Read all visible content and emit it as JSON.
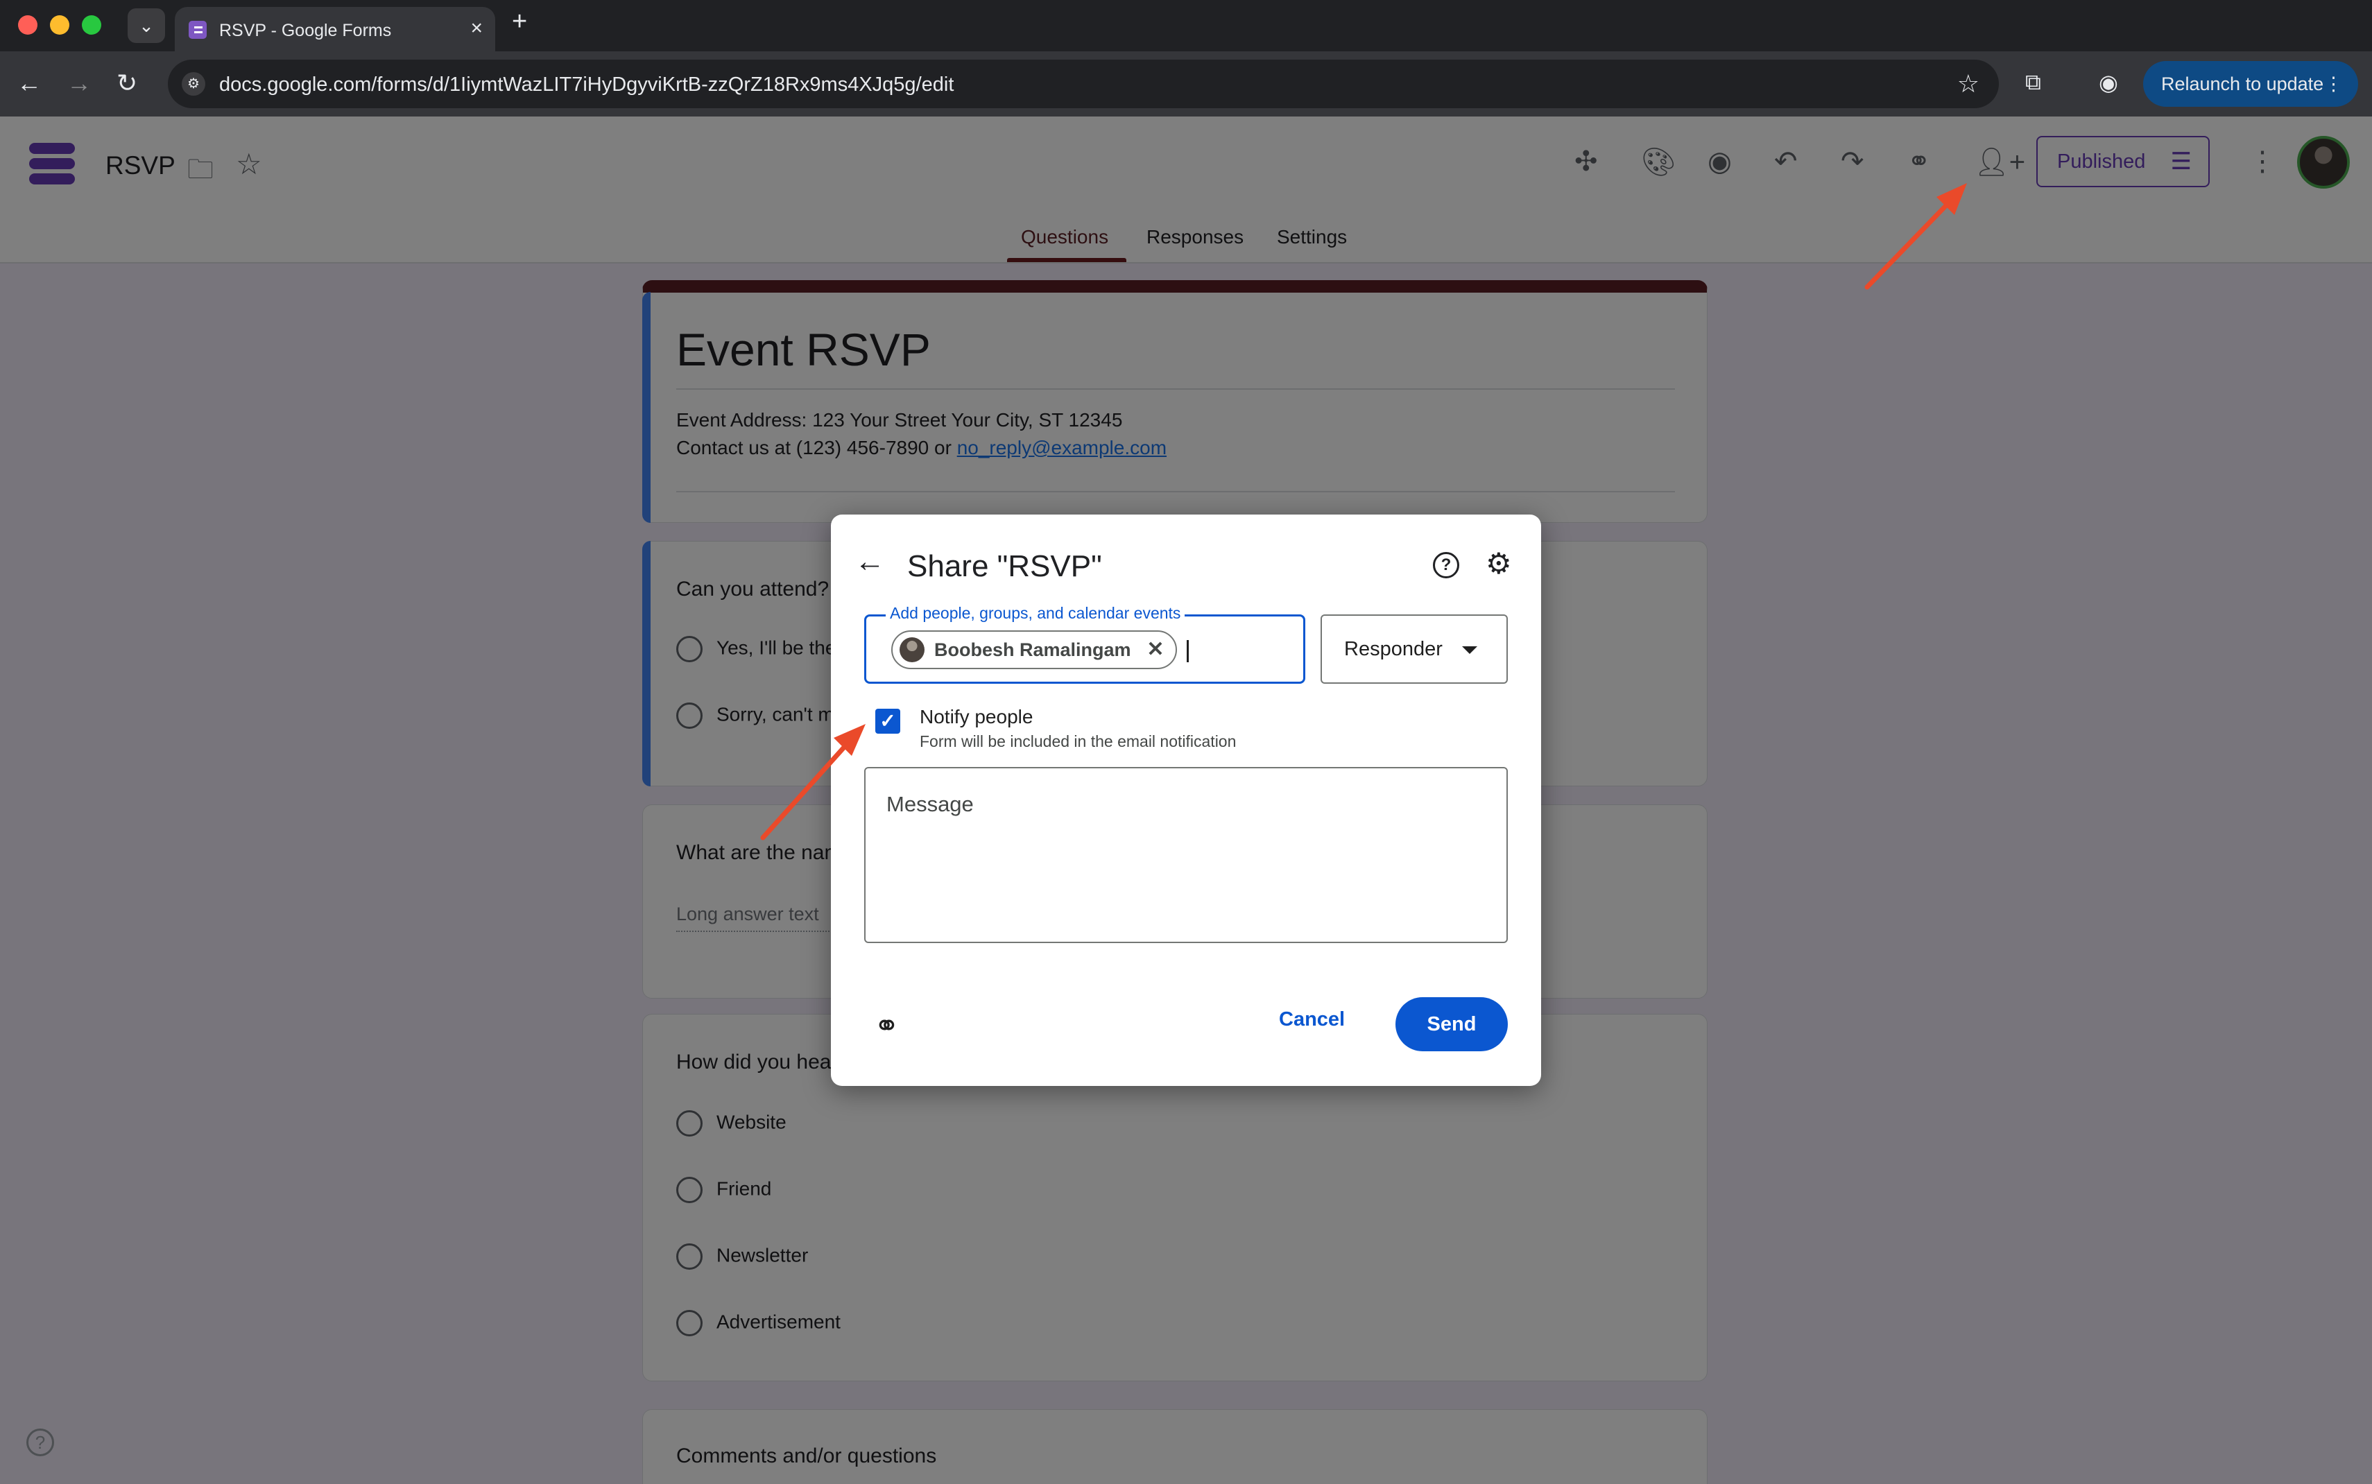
{
  "browser": {
    "tab_title": "RSVP - Google Forms",
    "tab_close": "×",
    "new_tab": "+",
    "url": "docs.google.com/forms/d/1IiymtWazLIT7iHyDgyviKrtB-zzQrZ18Rx9ms4XJq5g/edit",
    "relaunch_label": "Relaunch to update"
  },
  "header": {
    "doc_title": "RSVP",
    "published_label": "Published",
    "tabs": [
      {
        "label": "Questions"
      },
      {
        "label": "Responses"
      },
      {
        "label": "Settings"
      }
    ]
  },
  "form": {
    "title": "Event RSVP",
    "description_line1": "Event Address: 123 Your Street Your City, ST 12345",
    "description_line2_prefix": "Contact us at (123) 456-7890 or ",
    "description_email": "no_reply@example.com",
    "questions": [
      {
        "title": "Can you attend?",
        "options": [
          "Yes,  I'll be there",
          "Sorry, can't make it"
        ]
      },
      {
        "title": "What are the names of people you are bringing?",
        "placeholder": "Long answer text"
      },
      {
        "title": "How did you hear about this event?",
        "options": [
          "Website",
          "Friend",
          "Newsletter",
          "Advertisement"
        ]
      },
      {
        "title": "Comments and/or questions"
      }
    ]
  },
  "share_dialog": {
    "title": "Share \"RSVP\"",
    "people_label": "Add people, groups, and calendar events",
    "chip_name": "Boobesh Ramalingam",
    "role": "Responder",
    "notify_label": "Notify people",
    "notify_sub": "Form will be included in the email notification",
    "notify_checked": true,
    "message_placeholder": "Message",
    "cancel_label": "Cancel",
    "send_label": "Send"
  },
  "colors": {
    "accent": "#673ab7",
    "theme": "#5b1f24",
    "primary_blue": "#0b57d0",
    "annotation_arrow": "#ea4a2a"
  }
}
